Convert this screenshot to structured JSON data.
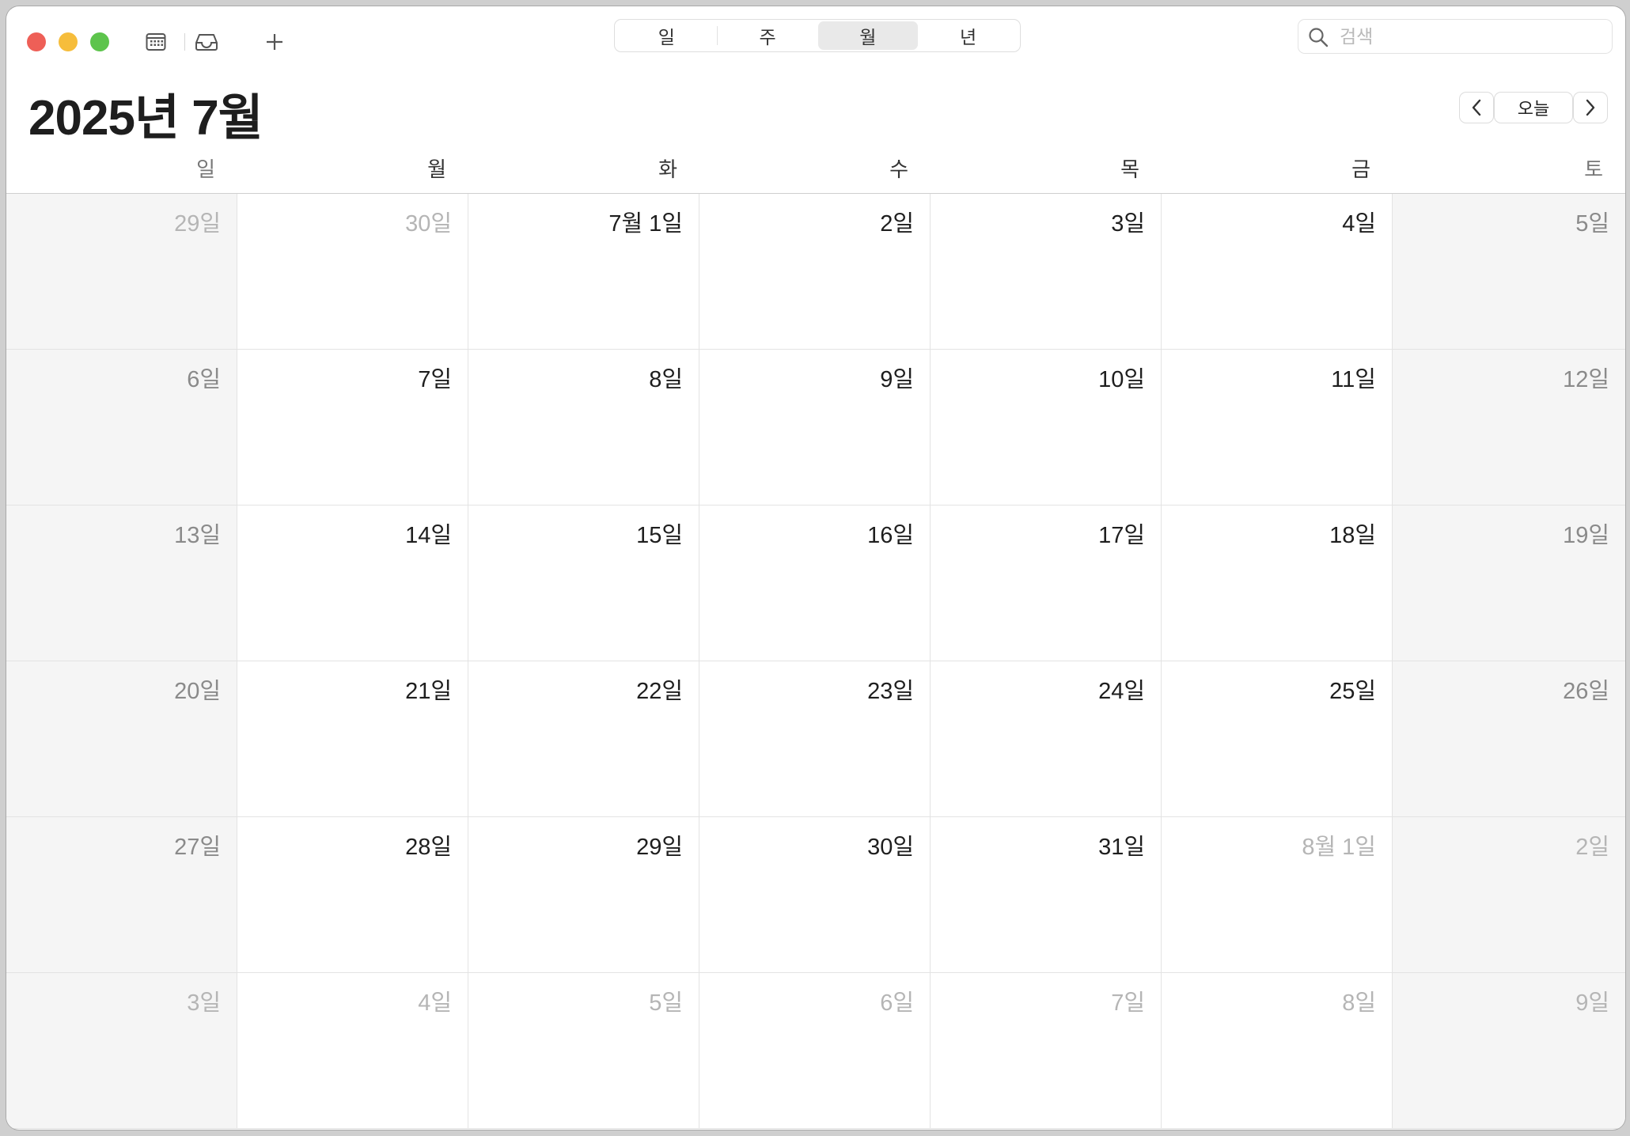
{
  "toolbar": {
    "view_tabs": [
      {
        "label": "일",
        "active": false
      },
      {
        "label": "주",
        "active": false
      },
      {
        "label": "월",
        "active": true
      },
      {
        "label": "년",
        "active": false
      }
    ],
    "search_placeholder": "검색"
  },
  "header": {
    "title": "2025년 7월",
    "today_label": "오늘"
  },
  "weekdays": [
    "일",
    "월",
    "화",
    "수",
    "목",
    "금",
    "토"
  ],
  "weeks": [
    [
      {
        "label": "29일",
        "other": true
      },
      {
        "label": "30일",
        "other": true
      },
      {
        "label": "7월 1일",
        "other": false
      },
      {
        "label": "2일",
        "other": false
      },
      {
        "label": "3일",
        "other": false
      },
      {
        "label": "4일",
        "other": false
      },
      {
        "label": "5일",
        "other": false
      }
    ],
    [
      {
        "label": "6일",
        "other": false
      },
      {
        "label": "7일",
        "other": false
      },
      {
        "label": "8일",
        "other": false
      },
      {
        "label": "9일",
        "other": false
      },
      {
        "label": "10일",
        "other": false
      },
      {
        "label": "11일",
        "other": false
      },
      {
        "label": "12일",
        "other": false
      }
    ],
    [
      {
        "label": "13일",
        "other": false
      },
      {
        "label": "14일",
        "other": false
      },
      {
        "label": "15일",
        "other": false
      },
      {
        "label": "16일",
        "other": false
      },
      {
        "label": "17일",
        "other": false
      },
      {
        "label": "18일",
        "other": false
      },
      {
        "label": "19일",
        "other": false
      }
    ],
    [
      {
        "label": "20일",
        "other": false
      },
      {
        "label": "21일",
        "other": false
      },
      {
        "label": "22일",
        "other": false
      },
      {
        "label": "23일",
        "other": false
      },
      {
        "label": "24일",
        "other": false
      },
      {
        "label": "25일",
        "other": false
      },
      {
        "label": "26일",
        "other": false
      }
    ],
    [
      {
        "label": "27일",
        "other": false
      },
      {
        "label": "28일",
        "other": false
      },
      {
        "label": "29일",
        "other": false
      },
      {
        "label": "30일",
        "other": false
      },
      {
        "label": "31일",
        "other": false
      },
      {
        "label": "8월 1일",
        "other": true
      },
      {
        "label": "2일",
        "other": true
      }
    ],
    [
      {
        "label": "3일",
        "other": true
      },
      {
        "label": "4일",
        "other": true
      },
      {
        "label": "5일",
        "other": true
      },
      {
        "label": "6일",
        "other": true
      },
      {
        "label": "7일",
        "other": true
      },
      {
        "label": "8일",
        "other": true
      },
      {
        "label": "9일",
        "other": true
      }
    ]
  ],
  "colors": {
    "close": "#ee5f57",
    "minimize": "#f6bd3b",
    "maximize": "#5dc44c",
    "weekend_bg": "#f5f5f5",
    "other_month_text": "#b5b5b5"
  }
}
